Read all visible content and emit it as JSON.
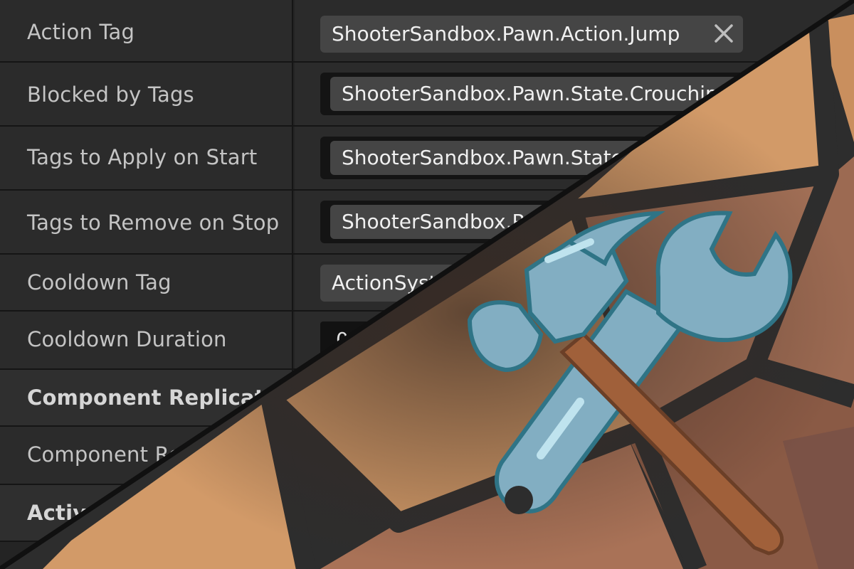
{
  "rows": [
    {
      "label": "Action Tag",
      "value": "ShooterSandbox.Pawn.Action.Jump"
    },
    {
      "label": "Blocked by Tags",
      "value": "ShooterSandbox.Pawn.State.Crouching"
    },
    {
      "label": "Tags to Apply on Start",
      "value": "ShooterSandbox.Pawn.State"
    },
    {
      "label": "Tags to Remove on Stop",
      "value": "ShooterSandbox.Pawn"
    },
    {
      "label": "Cooldown Tag",
      "value": "ActionSystem"
    },
    {
      "label": "Cooldown Duration",
      "value": "0"
    }
  ],
  "categories": {
    "component_replication": "Component Replication",
    "component_replicates": "Component Replicates",
    "activation": "Activation"
  },
  "icons": {
    "clear_tag": "close-icon",
    "emblem": "hammer-and-wrench-icon"
  },
  "colors": {
    "panel_bg": "#2b2b2b",
    "tag_bg": "#454545",
    "art_orange": "#d29a68",
    "art_brown": "#8a5a45",
    "tool_blue": "#82aec2"
  }
}
